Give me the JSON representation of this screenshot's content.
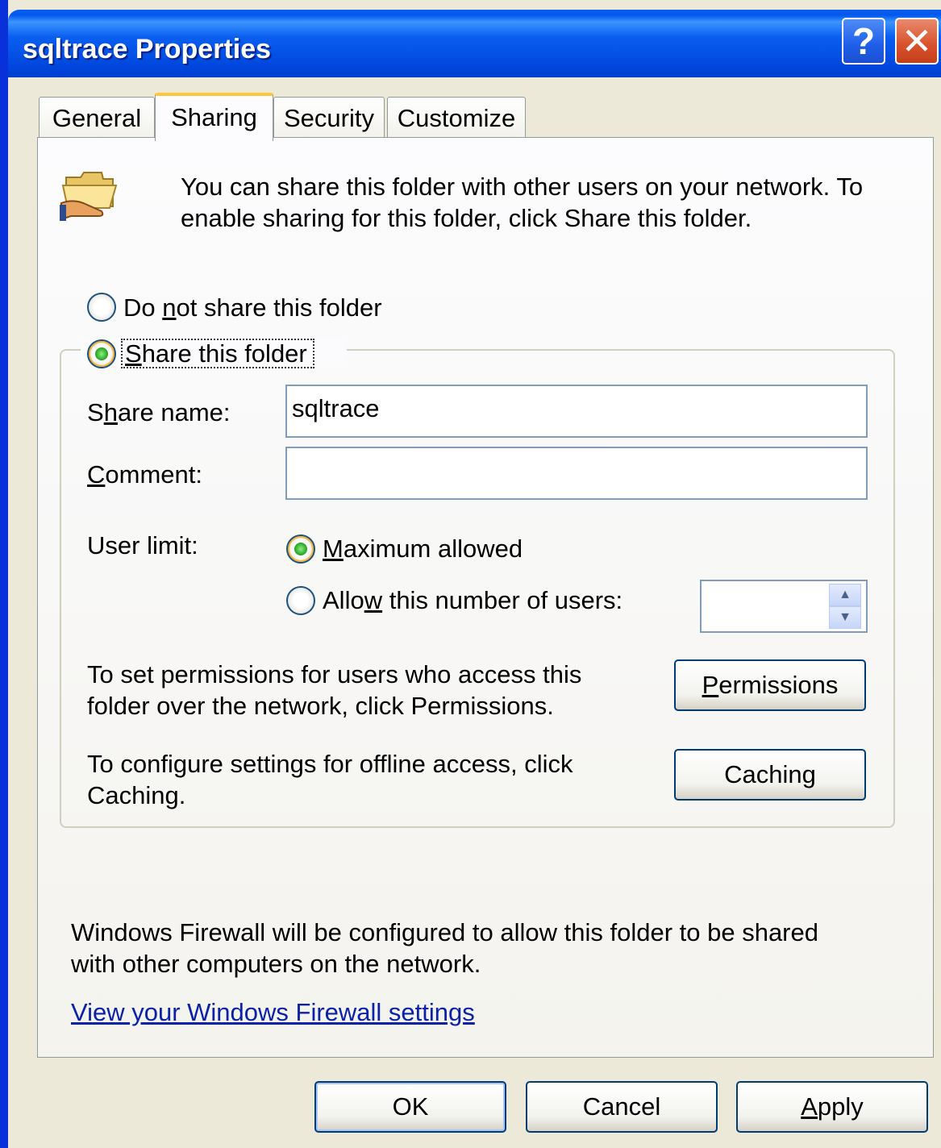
{
  "window": {
    "title": "sqltrace Properties",
    "help_label": "?",
    "close_label": "✕"
  },
  "tabs": [
    {
      "label": "General"
    },
    {
      "label": "Sharing"
    },
    {
      "label": "Security"
    },
    {
      "label": "Customize"
    }
  ],
  "intro": {
    "icon": "shared-folder-icon",
    "text_line1": "You can share this folder with other users on your network.  To",
    "text_line2": "enable sharing for this folder, click Share this folder."
  },
  "sharing": {
    "do_not_share": {
      "pre": "Do ",
      "accel": "n",
      "post": "ot share this folder",
      "selected": false
    },
    "share": {
      "accel": "S",
      "post": "hare this folder",
      "selected": true
    },
    "share_name_label": {
      "pre": "S",
      "accel": "h",
      "post": "are name:"
    },
    "share_name_value": "sqltrace",
    "comment_label": {
      "accel": "C",
      "post": "omment:"
    },
    "comment_value": "",
    "user_limit_label": "User limit:",
    "max_allowed": {
      "accel": "M",
      "post": "aximum allowed",
      "selected": true
    },
    "allow_number": {
      "pre": "Allo",
      "accel": "w",
      "post": " this number of users:",
      "selected": false
    },
    "user_count_value": "",
    "permissions_text_line1": "To set permissions for users who access this",
    "permissions_text_line2": "folder over the network, click Permissions.",
    "permissions_button": {
      "accel": "P",
      "post": "ermissions"
    },
    "caching_text_line1": "To configure settings for offline access, click",
    "caching_text_line2": "Caching.",
    "caching_button": {
      "pre": "Cachin",
      "accel": "g"
    }
  },
  "firewall": {
    "text_line1": "Windows Firewall will be configured to allow this folder to be shared",
    "text_line2": "with other computers on the network.",
    "link": "View your Windows Firewall settings"
  },
  "buttons": {
    "ok": "OK",
    "cancel": "Cancel",
    "apply": {
      "accel": "A",
      "post": "pply"
    }
  },
  "colors": {
    "titlebar": "#0058ee",
    "dialog": "#ece9d8",
    "link": "#0b21a8",
    "tab_highlight": "#ffc83c"
  }
}
